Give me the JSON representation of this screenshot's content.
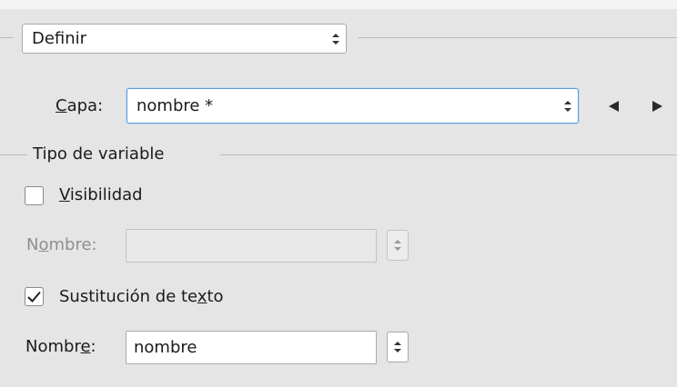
{
  "mode_select": {
    "value": "Definir"
  },
  "layer": {
    "label_mnemonic": "C",
    "label_rest": "apa:",
    "value": "nombre *",
    "prev_icon": "triangle-left-icon",
    "next_icon": "triangle-right-icon"
  },
  "variable_type": {
    "title": "Tipo de variable",
    "visibility": {
      "checked": false,
      "label_mnemonic": "V",
      "label_rest": "isibilidad",
      "name_label_pre": "N",
      "name_label_mnemonic": "o",
      "name_label_post": "mbre:",
      "name_value": "",
      "enabled": false
    },
    "text_replacement": {
      "checked": true,
      "label_pre": "Sustitución de te",
      "label_mnemonic": "x",
      "label_post": "to",
      "name_label_pre": "Nombr",
      "name_label_mnemonic": "e",
      "name_label_post": ":",
      "name_value": "nombre",
      "enabled": true
    }
  },
  "colors": {
    "background": "#e5e5e5",
    "focus_border": "#5e9ad6",
    "disabled_text": "#8f8f8f"
  }
}
